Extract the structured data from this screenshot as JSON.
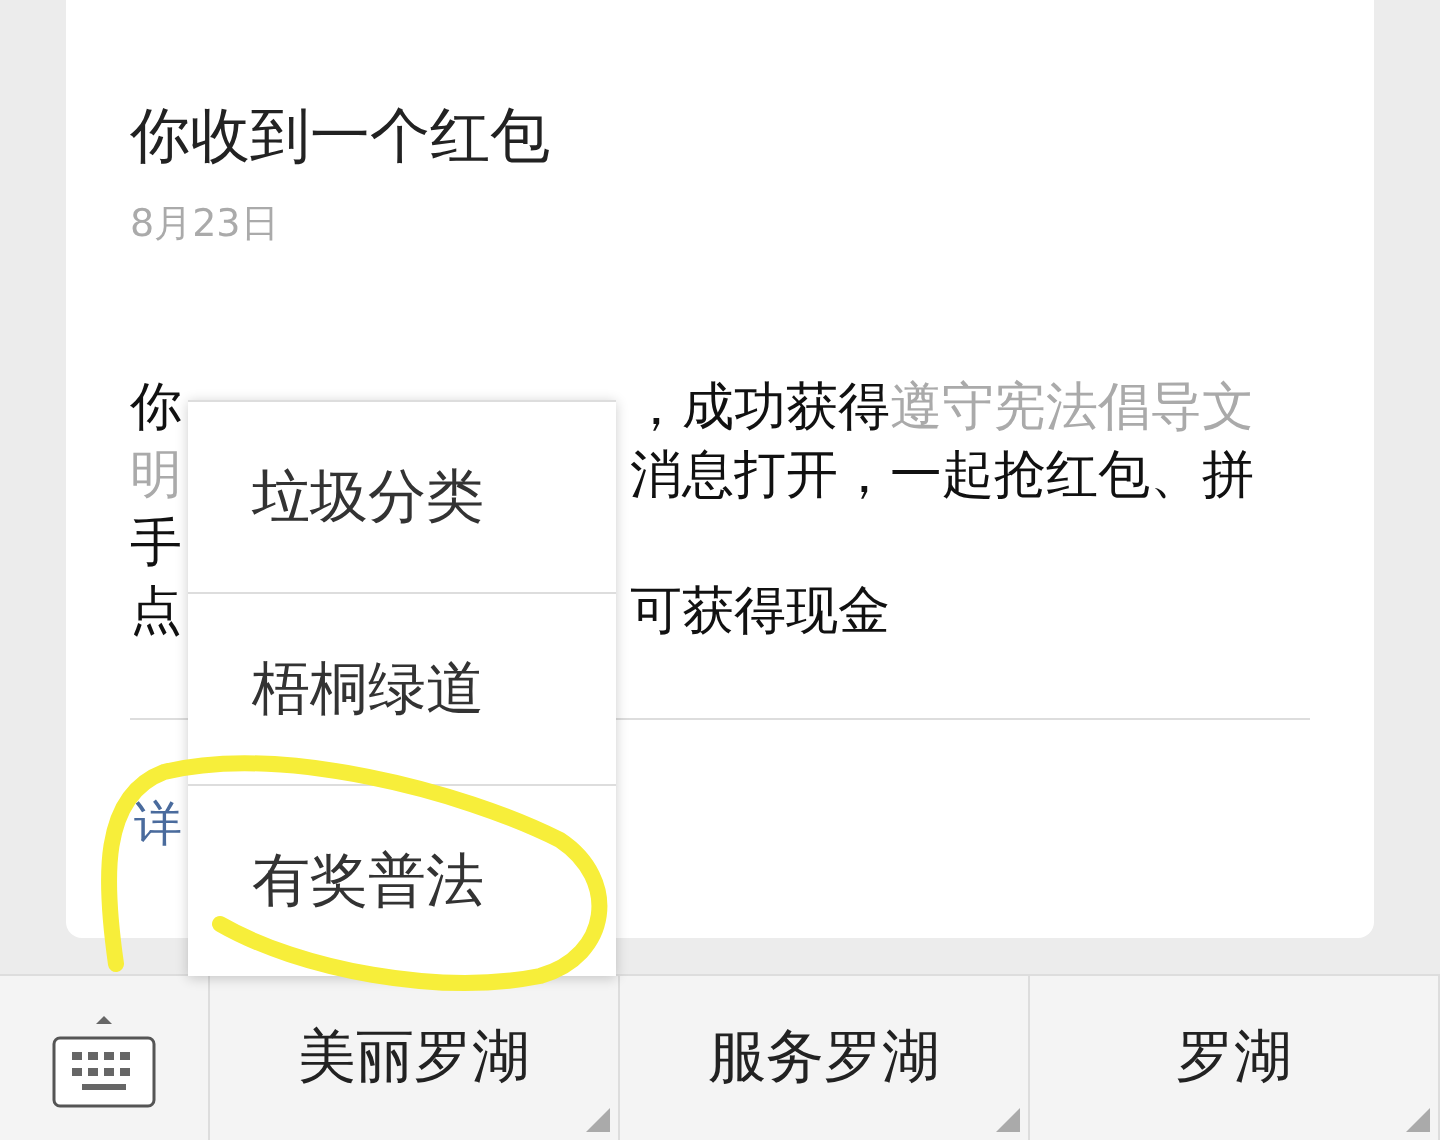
{
  "message": {
    "title": "你收到一个红包",
    "date": "8月23日",
    "body_lines": [
      {
        "parts": [
          [
            {
              "text": "你",
              "kind": "normal"
            }
          ],
          [
            {
              "text": "，成功获得",
              "kind": "normal"
            },
            {
              "text": "遵守宪法倡导文",
              "kind": "highlight"
            }
          ]
        ]
      },
      {
        "parts": [
          [
            {
              "text": "明",
              "kind": "highlight"
            }
          ],
          [
            {
              "text": "消息打开，一起抢红包、拼",
              "kind": "normal"
            }
          ]
        ]
      },
      {
        "parts": [
          [
            {
              "text": "手",
              "kind": "normal"
            }
          ]
        ]
      },
      {
        "parts": [
          [
            {
              "text": "点",
              "kind": "normal"
            }
          ],
          [
            {
              "text": "可获得现金",
              "kind": "normal"
            }
          ]
        ]
      }
    ],
    "link": "详"
  },
  "popup_menu": {
    "items": [
      {
        "label": "垃圾分类"
      },
      {
        "label": "梧桐绿道"
      },
      {
        "label": "有奖普法"
      }
    ]
  },
  "bottom_menu": {
    "buttons": [
      {
        "label": "美丽罗湖",
        "has_submenu": true
      },
      {
        "label": "服务罗湖",
        "has_submenu": true
      },
      {
        "label": "罗湖",
        "has_submenu": true
      }
    ]
  }
}
